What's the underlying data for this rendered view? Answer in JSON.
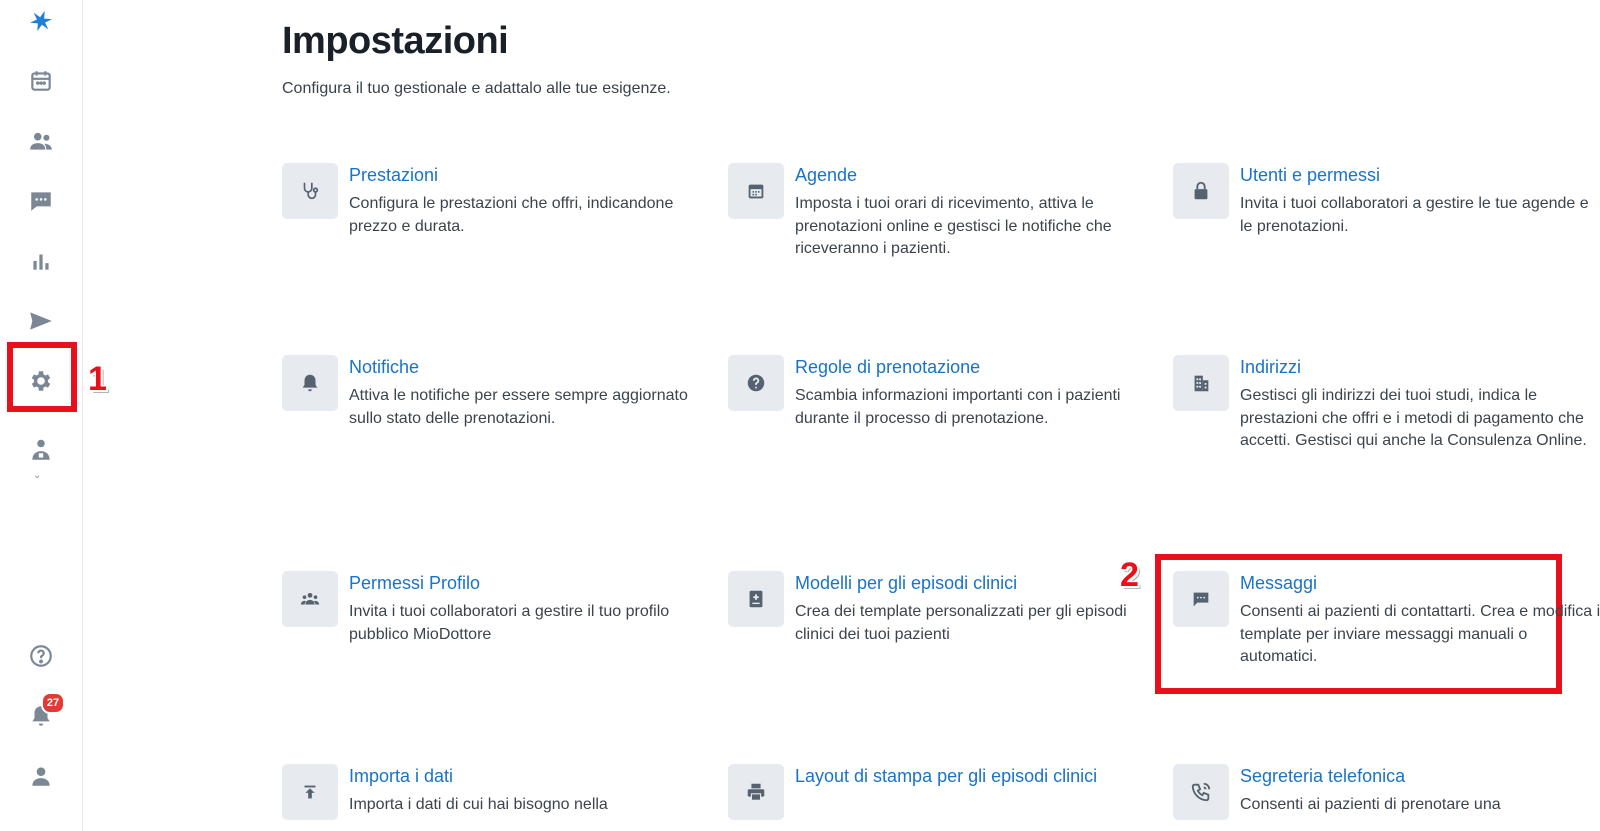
{
  "page": {
    "title": "Impostazioni",
    "subtitle": "Configura il tuo gestionale e adattalo alle tue esigenze."
  },
  "sidebar": {
    "items": [
      {
        "icon": "logo-icon"
      },
      {
        "icon": "calendar-icon"
      },
      {
        "icon": "patients-icon"
      },
      {
        "icon": "messages-icon"
      },
      {
        "icon": "stats-icon"
      },
      {
        "icon": "send-icon"
      },
      {
        "icon": "gear-icon"
      },
      {
        "icon": "doctor-icon"
      },
      {
        "icon": "help-icon"
      },
      {
        "icon": "bell-icon"
      },
      {
        "icon": "user-icon"
      }
    ],
    "notifications_count": "27"
  },
  "annotations": {
    "step1": "1",
    "step2": "2",
    "highlight_color": "#e8101a"
  },
  "cards": [
    {
      "title": "Prestazioni",
      "desc": "Configura le prestazioni che offri, indicandone prezzo e durata.",
      "icon": "stethoscope-icon"
    },
    {
      "title": "Agende",
      "desc": "Imposta i tuoi orari di ricevimento, attiva le prenotazioni online e gestisci le notifiche che riceveranno i pazienti.",
      "icon": "calendar-icon"
    },
    {
      "title": "Utenti e permessi",
      "desc": "Invita i tuoi collaboratori a gestire le tue agende e le prenotazioni.",
      "icon": "lock-icon"
    },
    {
      "title": "Notifiche",
      "desc": "Attiva le notifiche per essere sempre aggiornato sullo stato delle prenotazioni.",
      "icon": "bell-icon"
    },
    {
      "title": "Regole di prenotazione",
      "desc": "Scambia informazioni importanti con i pazienti durante il processo di prenotazione.",
      "icon": "question-icon"
    },
    {
      "title": "Indirizzi",
      "desc": "Gestisci gli indirizzi dei tuoi studi, indica le prestazioni che offri e i metodi di pagamento che accetti. Gestisci qui anche la Consulenza Online.",
      "icon": "building-icon"
    },
    {
      "title": "Permessi Profilo",
      "desc": "Invita i tuoi collaboratori a gestire il tuo profilo pubblico MioDottore",
      "icon": "group-icon"
    },
    {
      "title": "Modelli per gli episodi clinici",
      "desc": "Crea dei template personalizzati per gli episodi clinici dei tuoi pazienti",
      "icon": "medical-book-icon"
    },
    {
      "title": "Messaggi",
      "desc": "Consenti ai pazienti di contattarti. Crea e modifica i template per inviare messaggi manuali o automatici.",
      "icon": "chat-icon"
    },
    {
      "title": "Importa i dati",
      "desc": "Importa i dati di cui hai bisogno nella",
      "icon": "upload-icon"
    },
    {
      "title": "Layout di stampa per gli episodi clinici",
      "desc": "",
      "icon": "printer-icon"
    },
    {
      "title": "Segreteria telefonica",
      "desc": "Consenti ai pazienti di prenotare una",
      "icon": "phone-icon"
    }
  ],
  "colors": {
    "link": "#1a73c8",
    "icon_tile": "#e7eaee",
    "sidebar_icon": "#7b8794",
    "brand": "#1f7ed6"
  }
}
